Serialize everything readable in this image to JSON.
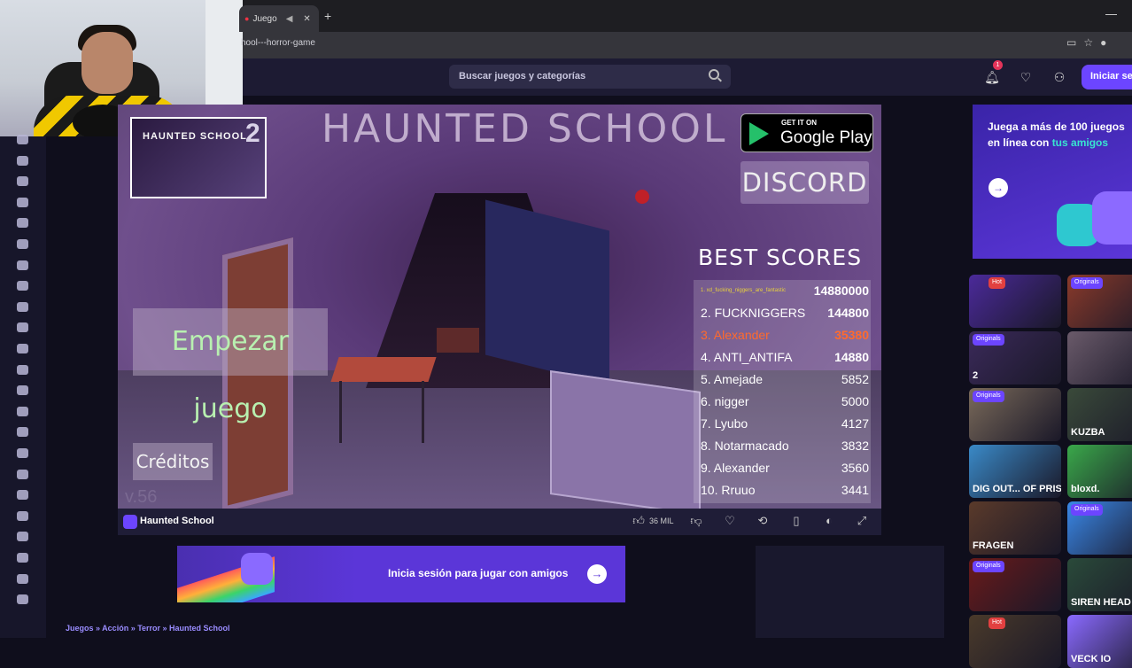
{
  "browser": {
    "tab_title": "Juego",
    "url": "hool---horror-game",
    "new_tab": "+",
    "minimize": "—"
  },
  "header": {
    "search_placeholder": "Buscar juegos y categorías",
    "notification_count": "1",
    "login_label": "Iniciar se"
  },
  "game": {
    "title": "HAUNTED SCHOOL",
    "google_play_small": "GET IT ON",
    "google_play_big": "Google Play",
    "discord_label": "DISCORD",
    "best_scores_title": "BEST SCORES",
    "scores": [
      {
        "name": "1. xd_fucking_niggers_are_fantastic",
        "value": "14880000"
      },
      {
        "name": "2. FUCKNIGGERS",
        "value": "144800"
      },
      {
        "name": "3. Alexander",
        "value": "35380"
      },
      {
        "name": "4. ANTI_ANTIFA",
        "value": "14880"
      },
      {
        "name": "5. Amejade",
        "value": "5852"
      },
      {
        "name": "6. nigger",
        "value": "5000"
      },
      {
        "name": "7. Lyubo",
        "value": "4127"
      },
      {
        "name": "8. Notarmacado",
        "value": "3832"
      },
      {
        "name": "9. Alexander",
        "value": "3560"
      },
      {
        "name": "10. Rruuo",
        "value": "3441"
      }
    ],
    "start_button": "Empezar juego",
    "credits_button": "Créditos",
    "version": "v.56",
    "thumb_title": "HAUNTED SCHOOL",
    "thumb_number": "2"
  },
  "game_bar": {
    "name": "Haunted School",
    "likes": "36 MIL"
  },
  "banner": {
    "text": "Inicia sesión para jugar con amigos",
    "arrow": "→"
  },
  "breadcrumb": "Juegos » Acción » Terror » Haunted School",
  "promo": {
    "line1": "Juega a más de 100 juegos en línea con ",
    "highlight": "tus amigos",
    "arrow": "→"
  },
  "tiles": [
    {
      "badges": [
        "Hot"
      ],
      "label": "",
      "color": "#4b2a9a"
    },
    {
      "badges": [
        "Originals"
      ],
      "label": "",
      "color": "#8a3a2a"
    },
    {
      "badges": [
        "Originals"
      ],
      "label": "2",
      "color": "#3b2a5a"
    },
    {
      "badges": [],
      "label": "",
      "color": "#6a5a6a"
    },
    {
      "badges": [
        "Originals"
      ],
      "label": "",
      "color": "#7a6a5a"
    },
    {
      "badges": [],
      "label": "KUZBA",
      "color": "#3a4a3a"
    },
    {
      "badges": [],
      "label": "DIG OUT... OF PRISON",
      "color": "#3a8ac8"
    },
    {
      "badges": [],
      "label": "bloxd.",
      "color": "#3aa84a"
    },
    {
      "badges": [],
      "label": "FRAGEN",
      "color": "#5a3a2a"
    },
    {
      "badges": [
        "Originals"
      ],
      "label": "",
      "color": "#3a88e8"
    },
    {
      "badges": [
        "Originals"
      ],
      "label": "",
      "color": "#6a1a1a"
    },
    {
      "badges": [],
      "label": "SIREN HEAD",
      "color": "#2a4a3a"
    },
    {
      "badges": [
        "Hot"
      ],
      "label": "",
      "color": "#4a3a2a"
    },
    {
      "badges": [],
      "label": "VECK IO",
      "color": "#8a6aff"
    }
  ],
  "colors": {
    "accent": "#6c45ff",
    "page_bg": "#0f0e1c",
    "header_bg": "#1d1b33",
    "score_highlight": "#ff6a2d",
    "start_text": "#b8f0b0"
  }
}
